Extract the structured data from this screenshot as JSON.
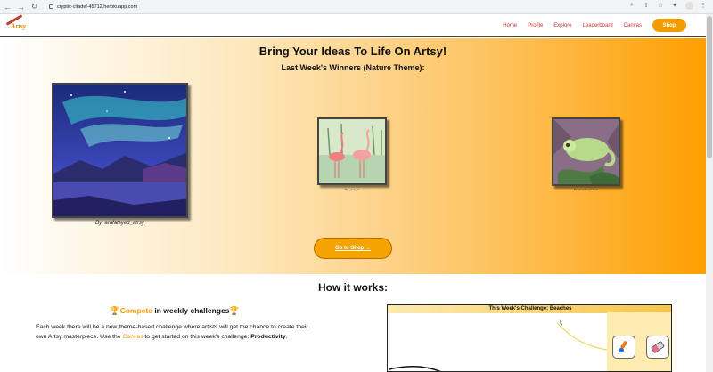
{
  "browser": {
    "url": "cryptic-citadel-45712.herokuapp.com"
  },
  "site": {
    "logo_text": "Artsy",
    "nav": [
      "Home",
      "Profile",
      "Explore",
      "Leaderboard",
      "Canvas"
    ],
    "shop_label": "Shop"
  },
  "hero": {
    "title": "Bring Your Ideas To Life On Artsy!",
    "subtitle": "Last Week's Winners (Nature Theme):",
    "winners": [
      {
        "caption": "By: arafatsyed_atrsy"
      },
      {
        "caption": "By: _ava_art"
      },
      {
        "caption": "By: anna9helpThatts"
      }
    ],
    "go_shop_label": "Go to Shop →"
  },
  "how": {
    "title": "How it works:",
    "compete_prefix": "🏆",
    "compete_word": "Compete",
    "compete_rest": " in weekly challenges",
    "compete_suffix": "🏆",
    "para_1": "Each week there will be a new theme-based challenge where artists will get the chance to create their own Artsy masterpiece. Use the ",
    "canvas_word": "Canvas",
    "para_2": " to get started on this week's challenge: ",
    "challenge_theme": "Productivity",
    "para_end": ".",
    "challenge_box_title": "This Week's Challenge: Beaches"
  },
  "colors": {
    "accent": "#f39c00",
    "nav_link": "#c0392b"
  }
}
